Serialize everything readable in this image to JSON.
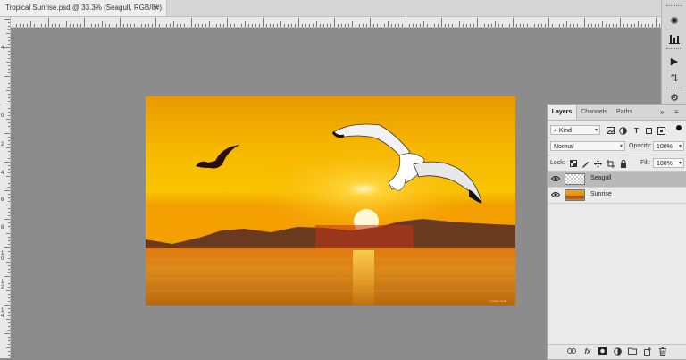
{
  "document_tab": {
    "title": "Tropical Sunrise.psd @ 33.3% (Seagull, RGB/8#)",
    "close_glyph": "×"
  },
  "vertical_ruler": {
    "labels": [
      "4",
      "0",
      "2",
      "4",
      "6",
      "8",
      "1\n0",
      "1\n2",
      "1\n4"
    ]
  },
  "right_toolbar": {
    "icons": [
      "sun-icon",
      "bar-chart-icon",
      "play-icon",
      "channel-swap-icon",
      "settings-icon"
    ],
    "glyphs": {
      "sun": "✺",
      "play": "▶",
      "swap": "⇅",
      "gear": "⚙"
    }
  },
  "layers_panel": {
    "tabs": [
      {
        "label": "Layers",
        "active": true
      },
      {
        "label": "Channels",
        "active": false
      },
      {
        "label": "Paths",
        "active": false
      }
    ],
    "collapse_glyph": "»",
    "menu_glyph": "≡",
    "filter": {
      "label": "Kind",
      "search_glyph": "⌕"
    },
    "blend_mode": "Normal",
    "opacity_label": "Opacity:",
    "opacity_value": "100%",
    "lock_label": "Lock:",
    "fill_label": "Fill:",
    "fill_value": "100%",
    "layers": [
      {
        "name": "Seagull",
        "selected": true,
        "visible": true
      },
      {
        "name": "Sunrise",
        "selected": false,
        "visible": true
      }
    ],
    "footer_icons": [
      "link-icon",
      "fx-icon",
      "mask-icon",
      "adjustment-icon",
      "folder-icon",
      "new-layer-icon",
      "trash-icon"
    ],
    "fx_label": "fx"
  },
  "image_watermark": "© photo credit",
  "colors": {
    "workspace": "#8c8c8c",
    "panel": "#eaeaea",
    "selected_layer": "#b9b9b9",
    "sky_top": "#f4a600",
    "sun": "#fff4c0"
  }
}
